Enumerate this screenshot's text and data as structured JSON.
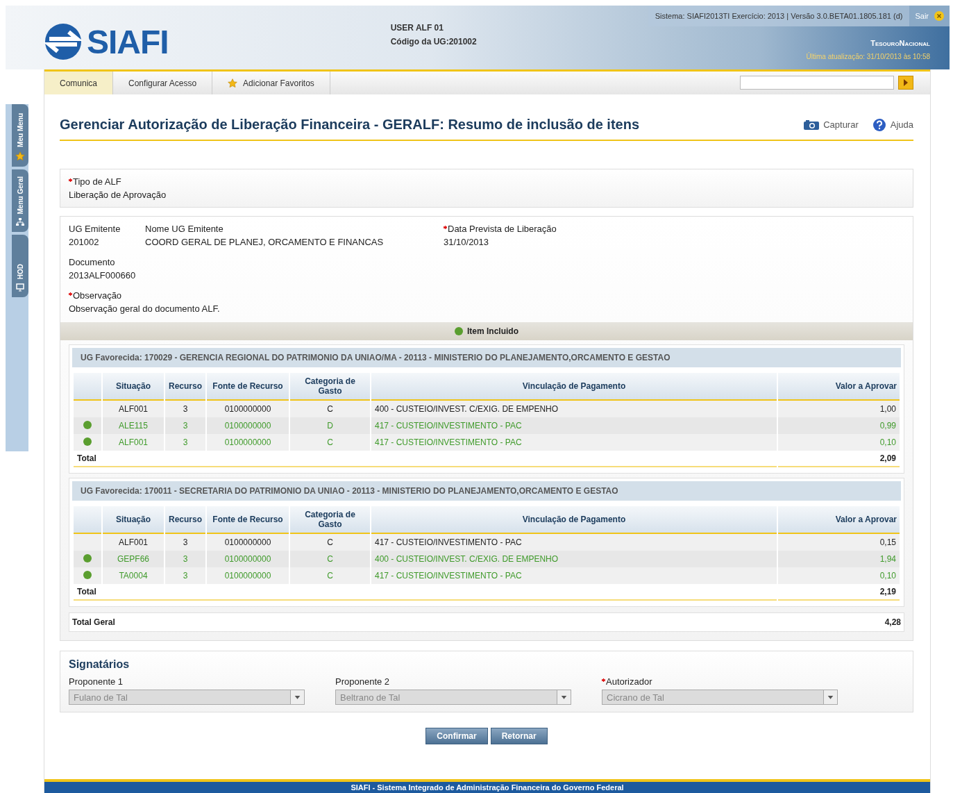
{
  "header": {
    "logo": "SIAFI",
    "user": "USER ALF 01",
    "ug_label": "Código da UG:",
    "ug_value": "201002",
    "system_info": "Sistema: SIAFI2013TI Exercício: 2013 | Versão 3.0.BETA01.1805.181 (d)",
    "exit": "Sair",
    "brand": "TesouroNacional",
    "last_update": "Última atualização: 31/10/2013 às 10:58"
  },
  "side_tabs": [
    {
      "label": "Meu Menu"
    },
    {
      "label": "Menu Geral"
    },
    {
      "label": "HOD"
    }
  ],
  "nav": {
    "items": [
      {
        "label": "Comunica",
        "selected": true
      },
      {
        "label": "Configurar Acesso",
        "selected": false
      },
      {
        "label": "Adicionar Favoritos",
        "selected": false
      }
    ]
  },
  "title": "Gerenciar Autorização de Liberação Financeira - GERALF: Resumo de inclusão de itens",
  "actions": [
    {
      "label": "Capturar"
    },
    {
      "label": "Ajuda"
    }
  ],
  "type_field": {
    "label": "Tipo de ALF",
    "required": true,
    "value": "Liberação de Aprovação"
  },
  "fields": [
    {
      "label": "UG Emitente",
      "required": false,
      "value": "201002"
    },
    {
      "label": "Nome UG Emitente",
      "required": false,
      "value": "COORD GERAL DE PLANEJ, ORCAMENTO E FINANCAS"
    },
    {
      "label": "Data Prevista de Liberação",
      "required": true,
      "value": "31/10/2013"
    }
  ],
  "document": {
    "label": "Documento",
    "required": false,
    "value": "2013ALF000660"
  },
  "observation": {
    "label": "Observação",
    "required": true,
    "value": "Observação geral do documento ALF."
  },
  "legend": {
    "label": "Item Incluido",
    "color": "#5a9e2f"
  },
  "groups": [
    {
      "heading": "UG Favorecida: 170029 - GERENCIA REGIONAL DO PATRIMONIO DA UNIAO/MA - 20113 - MINISTERIO DO PLANEJAMENTO,ORCAMENTO E GESTAO",
      "columns": [
        "Situação",
        "Recurso",
        "Fonte de Recurso",
        "Categoria de Gasto",
        "Vinculação de Pagamento",
        "Valor a Aprovar"
      ],
      "rows": [
        {
          "included": false,
          "cells": [
            "ALF001",
            "3",
            "0100000000",
            "C",
            "400 - CUSTEIO/INVEST. C/EXIG. DE EMPENHO",
            "1,00"
          ]
        },
        {
          "included": true,
          "cells": [
            "ALE115",
            "3",
            "0100000000",
            "D",
            "417 - CUSTEIO/INVESTIMENTO - PAC",
            "0,99"
          ]
        },
        {
          "included": true,
          "cells": [
            "ALF001",
            "3",
            "0100000000",
            "C",
            "417 - CUSTEIO/INVESTIMENTO - PAC",
            "0,10"
          ]
        }
      ],
      "total_label": "Total",
      "total": "2,09"
    },
    {
      "heading": "UG Favorecida: 170011 - SECRETARIA DO PATRIMONIO DA UNIAO - 20113 - MINISTERIO DO PLANEJAMENTO,ORCAMENTO E GESTAO",
      "columns": [
        "Situação",
        "Recurso",
        "Fonte de Recurso",
        "Categoria de Gasto",
        "Vinculação de Pagamento",
        "Valor a Aprovar"
      ],
      "rows": [
        {
          "included": false,
          "cells": [
            "ALF001",
            "3",
            "0100000000",
            "C",
            "417 - CUSTEIO/INVESTIMENTO - PAC",
            "0,15"
          ]
        },
        {
          "included": true,
          "cells": [
            "GEPF66",
            "3",
            "0100000000",
            "C",
            "400 - CUSTEIO/INVEST. C/EXIG. DE EMPENHO",
            "1,94"
          ]
        },
        {
          "included": true,
          "cells": [
            "TA0004",
            "3",
            "0100000000",
            "C",
            "417 - CUSTEIO/INVESTIMENTO - PAC",
            "0,10"
          ]
        }
      ],
      "total_label": "Total",
      "total": "2,19"
    }
  ],
  "grand_total": {
    "label": "Total Geral",
    "value": "4,28"
  },
  "signatories": {
    "title": "Signatários",
    "fields": [
      {
        "label": "Proponente 1",
        "required": false,
        "value": "Fulano de Tal",
        "disabled": true
      },
      {
        "label": "Proponente 2",
        "required": false,
        "value": "Beltrano de Tal",
        "disabled": true
      },
      {
        "label": "Autorizador",
        "required": true,
        "value": "Cicrano de Tal",
        "disabled": true
      }
    ]
  },
  "buttons": [
    "Confirmar",
    "Retornar"
  ],
  "footer": "SIAFI - Sistema Integrado de Administração Financeira do Governo Federal"
}
